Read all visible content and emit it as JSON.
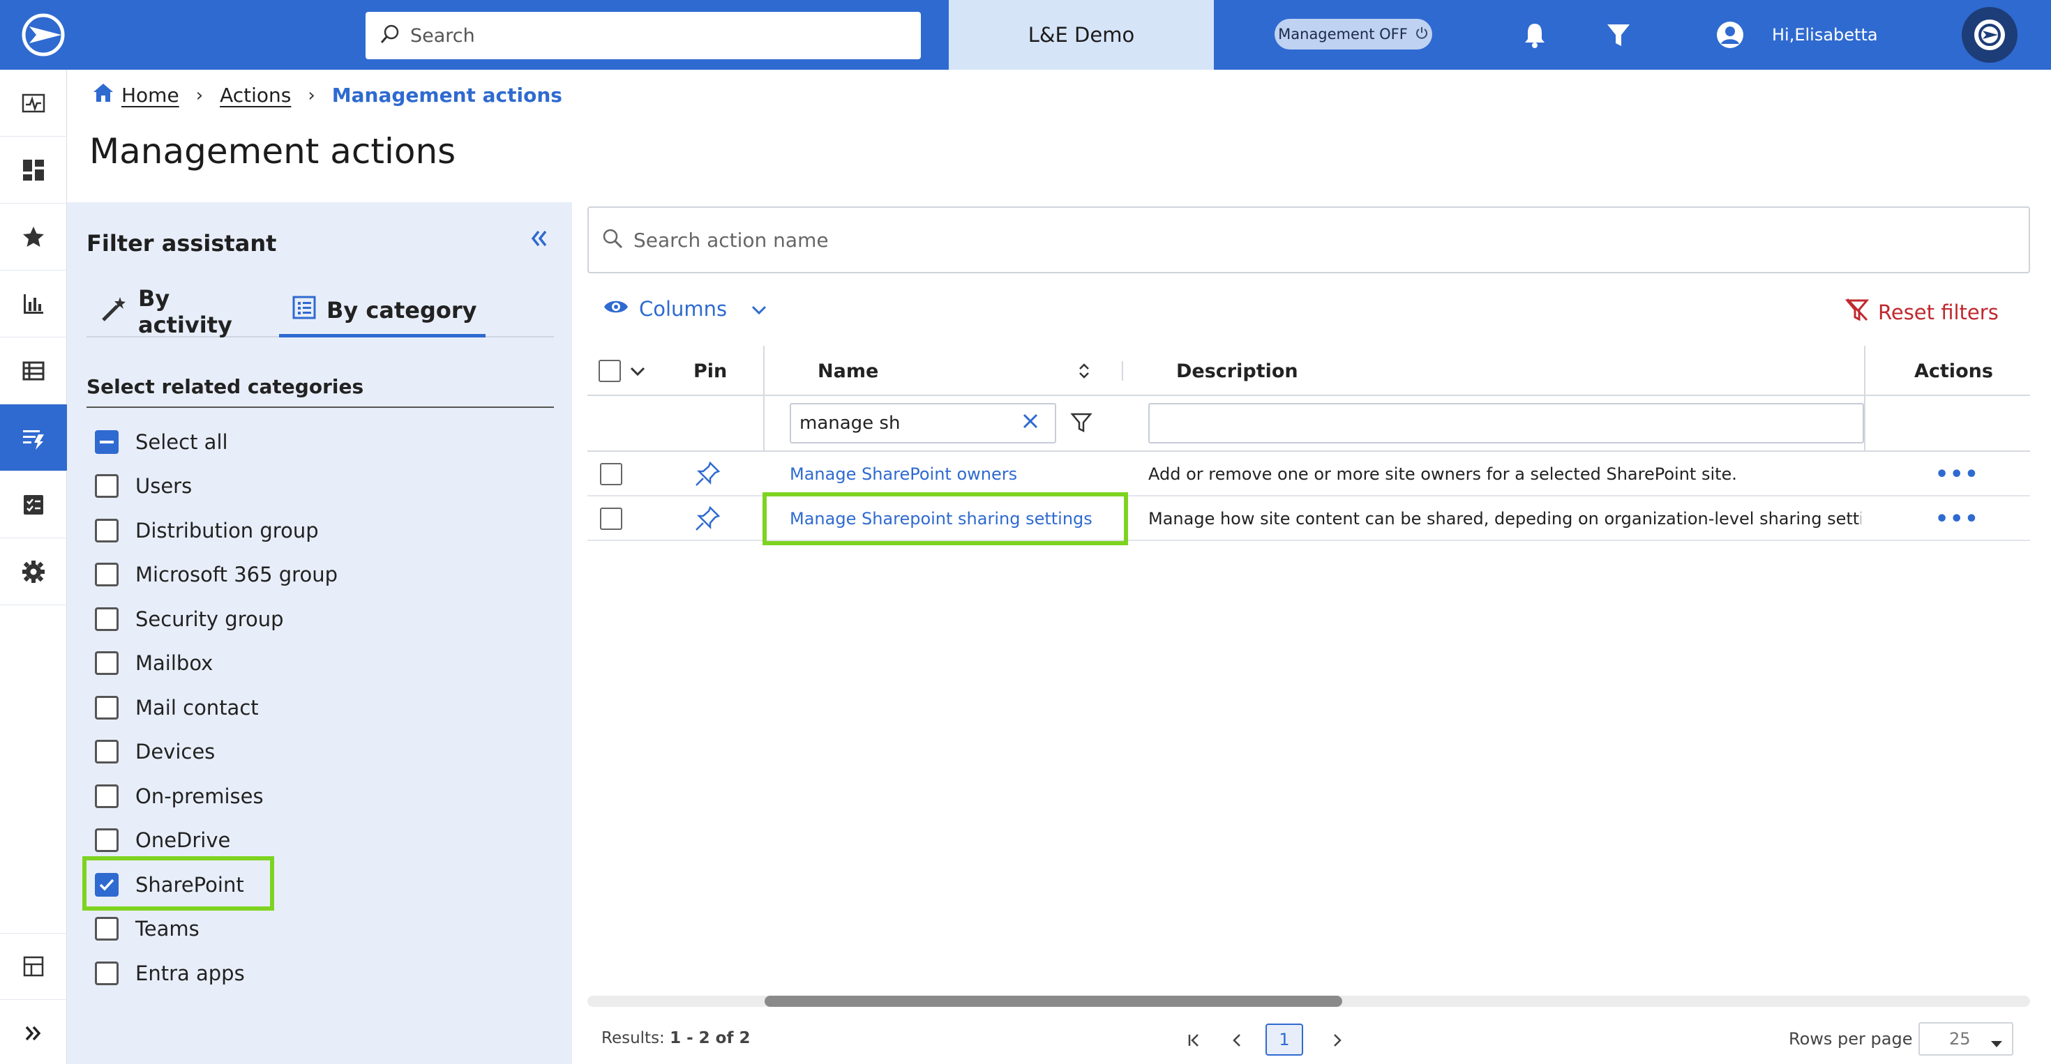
{
  "topbar": {
    "search_placeholder": "Search",
    "tenant": "L&E Demo",
    "management_toggle": "Management OFF",
    "user_greeting": "Hi,Elisabetta"
  },
  "breadcrumb": {
    "home": "Home",
    "actions": "Actions",
    "current": "Management actions"
  },
  "page_title": "Management actions",
  "filter_assistant": {
    "title": "Filter assistant",
    "tabs": [
      {
        "label": "By activity",
        "active": false
      },
      {
        "label": "By category",
        "active": true
      }
    ],
    "subtitle": "Select related categories",
    "categories": [
      {
        "label": "Select all",
        "state": "partial"
      },
      {
        "label": "Users",
        "state": "unchecked"
      },
      {
        "label": "Distribution group",
        "state": "unchecked"
      },
      {
        "label": "Microsoft 365 group",
        "state": "unchecked"
      },
      {
        "label": "Security group",
        "state": "unchecked"
      },
      {
        "label": "Mailbox",
        "state": "unchecked"
      },
      {
        "label": "Mail contact",
        "state": "unchecked"
      },
      {
        "label": "Devices",
        "state": "unchecked"
      },
      {
        "label": "On-premises",
        "state": "unchecked"
      },
      {
        "label": "OneDrive",
        "state": "unchecked"
      },
      {
        "label": "SharePoint",
        "state": "checked"
      },
      {
        "label": "Teams",
        "state": "unchecked"
      },
      {
        "label": "Entra apps",
        "state": "unchecked"
      }
    ]
  },
  "main": {
    "search_placeholder": "Search action name",
    "columns_label": "Columns",
    "reset_label": "Reset filters",
    "headers": {
      "pin": "Pin",
      "name": "Name",
      "description": "Description",
      "actions": "Actions"
    },
    "name_filter_value": "manage sh",
    "rows": [
      {
        "name": "Manage SharePoint owners",
        "description": "Add or remove one or more site owners for a selected SharePoint site."
      },
      {
        "name": "Manage Sharepoint sharing settings",
        "description": "Manage how site content can be shared, depeding on organization-level sharing settings. Inc"
      }
    ],
    "row_actions": "•••",
    "results_prefix": "Results: ",
    "results_range": "1 - 2 of 2",
    "current_page": "1",
    "rows_per_page_label": "Rows per page",
    "rows_per_page_value": "25"
  },
  "colors": {
    "primary": "#2f6ad0",
    "highlight": "#7ed321",
    "danger": "#c0282e",
    "panel_bg": "#e8eef9"
  }
}
